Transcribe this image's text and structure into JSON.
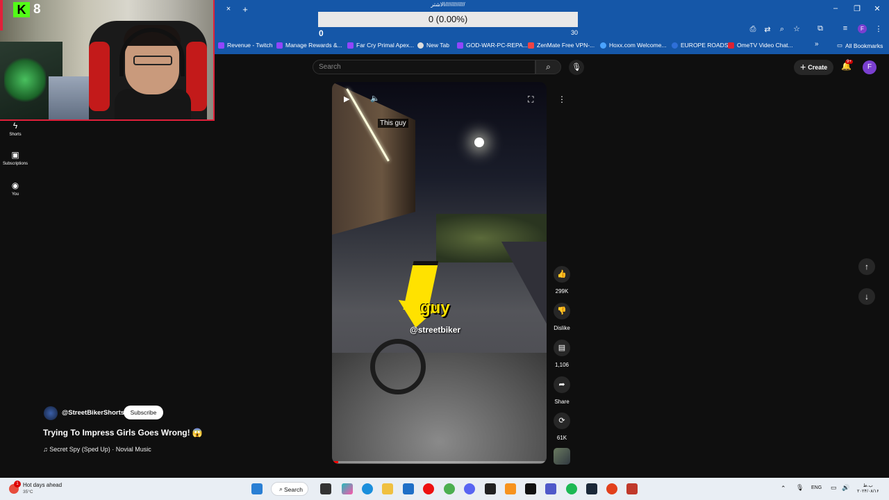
{
  "browser": {
    "tab_close": "×",
    "new_tab": "+",
    "bookmarks": [
      {
        "label": "Revenue - Twitch",
        "color": "#9146ff"
      },
      {
        "label": "Manage Rewards &...",
        "color": "#9146ff"
      },
      {
        "label": "Far Cry Primal Apex...",
        "color": "#9146ff"
      },
      {
        "label": "New Tab",
        "color": "#dddddd"
      },
      {
        "label": "GOD-WAR-PC-REPA...",
        "color": "#9146ff"
      },
      {
        "label": "ZenMate Free VPN-...",
        "color": "#e44"
      },
      {
        "label": "Hoxx.com Welcome...",
        "color": "#4aa3ff"
      },
      {
        "label": "EUROPE ROADS",
        "color": "#2e6fd8"
      },
      {
        "label": "OmeTV Video Chat...",
        "color": "#d23"
      }
    ],
    "bookmarks_overflow": "»",
    "all_bookmarks": "All Bookmarks",
    "account_initial": "F"
  },
  "overlay": {
    "title": "الاشتر/////////////",
    "progress_text": "0 (0.00%)",
    "min": "0",
    "max": "30"
  },
  "webcam": {
    "platform_logo": "K",
    "viewer_count": "8"
  },
  "sidebar": {
    "items": [
      {
        "label": "Shorts",
        "icon": "shorts-icon"
      },
      {
        "label": "Subscriptions",
        "icon": "subscriptions-icon"
      },
      {
        "label": "You",
        "icon": "you-icon"
      }
    ]
  },
  "header": {
    "search_placeholder": "Search",
    "create_label": "Create",
    "notifications_badge": "9+",
    "account_initial": "F"
  },
  "video": {
    "caption_top": "This guy",
    "caption_word": "guy",
    "watermark_handle": "@streetbiker",
    "progress": 0.03
  },
  "actions": {
    "likes": "299K",
    "dislike_label": "Dislike",
    "comments": "1,106",
    "share_label": "Share",
    "remix": "61K"
  },
  "channel": {
    "name": "@StreetBikerShorts",
    "subscribe_label": "Subscribe",
    "title": "Trying To Impress Girls Goes Wrong! 😱",
    "music": "♫ Secret Spy (Sped Up) · Novial Music"
  },
  "taskbar": {
    "weather_title": "Hot days ahead",
    "weather_temp": "35°C",
    "weather_alert": "1",
    "search_label": "Search",
    "language": "ENG",
    "clock_time": "ب.ظ",
    "clock_date": "۲۰۲۴/۰۸/۱۶"
  },
  "colors": {
    "chrome_blue": "#1557a8",
    "kick_green": "#53fc18",
    "arrow_yellow": "#ffe200"
  }
}
